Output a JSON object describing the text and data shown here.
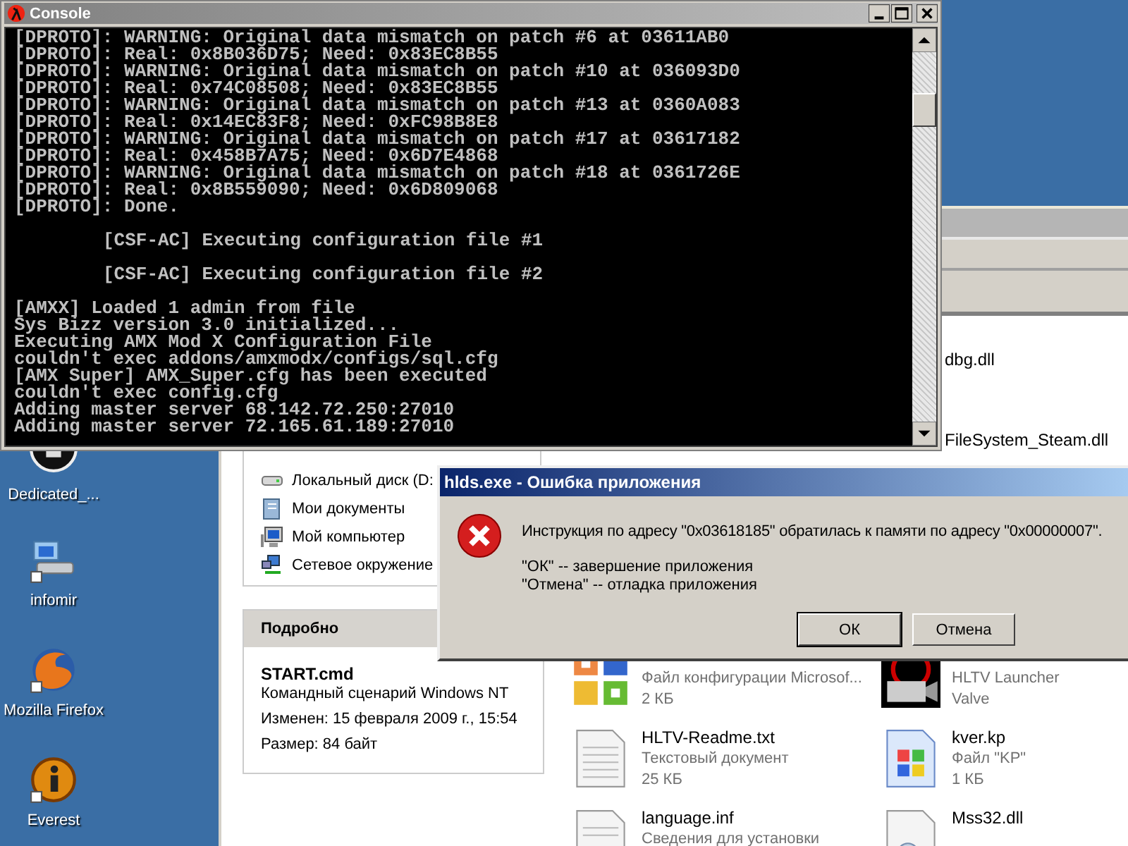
{
  "console": {
    "title": "Console",
    "lines": [
      {
        "kind": "plain",
        "text": "[DPROTO]: WARNING: Original data mismatch on patch #6 at 03611AB0"
      },
      {
        "kind": "plain",
        "text": "[DPROTO]: Real: 0x8B036D75; Need: 0x83EC8B55"
      },
      {
        "kind": "plain",
        "text": "[DPROTO]: WARNING: Original data mismatch on patch #10 at 036093D0"
      },
      {
        "kind": "plain",
        "text": "[DPROTO]: Real: 0x74C08508; Need: 0x83EC8B55"
      },
      {
        "kind": "plain",
        "text": "[DPROTO]: WARNING: Original data mismatch on patch #13 at 0360A083"
      },
      {
        "kind": "plain",
        "text": "[DPROTO]: Real: 0x14EC83F8; Need: 0xFC98B8E8"
      },
      {
        "kind": "plain",
        "text": "[DPROTO]: WARNING: Original data mismatch on patch #17 at 03617182"
      },
      {
        "kind": "plain",
        "text": "[DPROTO]: Real: 0x458B7A75; Need: 0x6D7E4868"
      },
      {
        "kind": "plain",
        "text": "[DPROTO]: WARNING: Original data mismatch on patch #18 at 0361726E"
      },
      {
        "kind": "plain",
        "text": "[DPROTO]: Real: 0x8B559090; Need: 0x6D809068"
      },
      {
        "kind": "plain",
        "text": "[DPROTO]: Done."
      },
      {
        "kind": "indented",
        "text": "[CSF-AC] Executing configuration file #1"
      },
      {
        "kind": "indented",
        "text": "[CSF-AC] Executing configuration file #2"
      },
      {
        "kind": "plain",
        "text": "[AMXX] Loaded 1 admin from file"
      },
      {
        "kind": "plain",
        "text": "Sys Bizz version 3.0 initialized..."
      },
      {
        "kind": "plain",
        "text": "Executing AMX Mod X Configuration File"
      },
      {
        "kind": "plain",
        "text": "couldn't exec addons/amxmodx/configs/sql.cfg"
      },
      {
        "kind": "plain",
        "text": "[AMX Super] AMX_Super.cfg has been executed"
      },
      {
        "kind": "plain",
        "text": "couldn't exec config.cfg"
      },
      {
        "kind": "plain",
        "text": "Adding master server 68.142.72.250:27010"
      },
      {
        "kind": "plain",
        "text": "Adding master server 72.165.61.189:27010"
      }
    ]
  },
  "desktop_icons": [
    {
      "label": "Dedicated_...",
      "kind": "server"
    },
    {
      "label": "infomir",
      "kind": "network"
    },
    {
      "label": "Mozilla Firefox",
      "kind": "browser"
    },
    {
      "label": "Everest",
      "kind": "info"
    }
  ],
  "explorer": {
    "other_places": [
      {
        "label": "Локальный диск (D:",
        "kind": "drive"
      },
      {
        "label": "Мои документы",
        "kind": "documents"
      },
      {
        "label": "Мой компьютер",
        "kind": "computer"
      },
      {
        "label": "Сетевое окружение",
        "kind": "network"
      }
    ],
    "details": {
      "title": "Подробно",
      "file_name": "START.cmd",
      "file_type": "Командный сценарий Windows NT",
      "modified": "Изменен: 15 февраля 2009 г., 15:54",
      "size": "Размер: 84 байт"
    },
    "files": [
      {
        "name": "dbg.dll"
      },
      {
        "name": "FileSystem_Steam.dll"
      },
      {
        "kind": "config",
        "lines": [
          "Файл конфигурации Microsof...",
          "2 КБ"
        ]
      },
      {
        "kind": "launcher",
        "lines": [
          "HLTV Launcher",
          "Valve"
        ]
      },
      {
        "kind": "text",
        "name": "HLTV-Readme.txt",
        "lines": [
          "Текстовый документ",
          "25 КБ"
        ]
      },
      {
        "kind": "system",
        "name": "kver.kp",
        "lines": [
          "Файл \"KP\"",
          "1 КБ"
        ]
      },
      {
        "kind": "inf",
        "name": "language.inf",
        "lines": [
          "Сведения для установки"
        ]
      },
      {
        "kind": "dll",
        "name": "Mss32.dll"
      }
    ]
  },
  "dialog": {
    "title": "hlds.exe - Ошибка приложения",
    "message": "Инструкция по адресу \"0x03618185\" обратилась к памяти по адресу \"0x00000007\".",
    "hints": [
      "\"ОК\" -- завершение приложения",
      "\"Отмена\" -- отладка приложения"
    ],
    "buttons": [
      {
        "label": "ОК",
        "default": true
      },
      {
        "label": "Отмена",
        "default": false
      }
    ]
  }
}
